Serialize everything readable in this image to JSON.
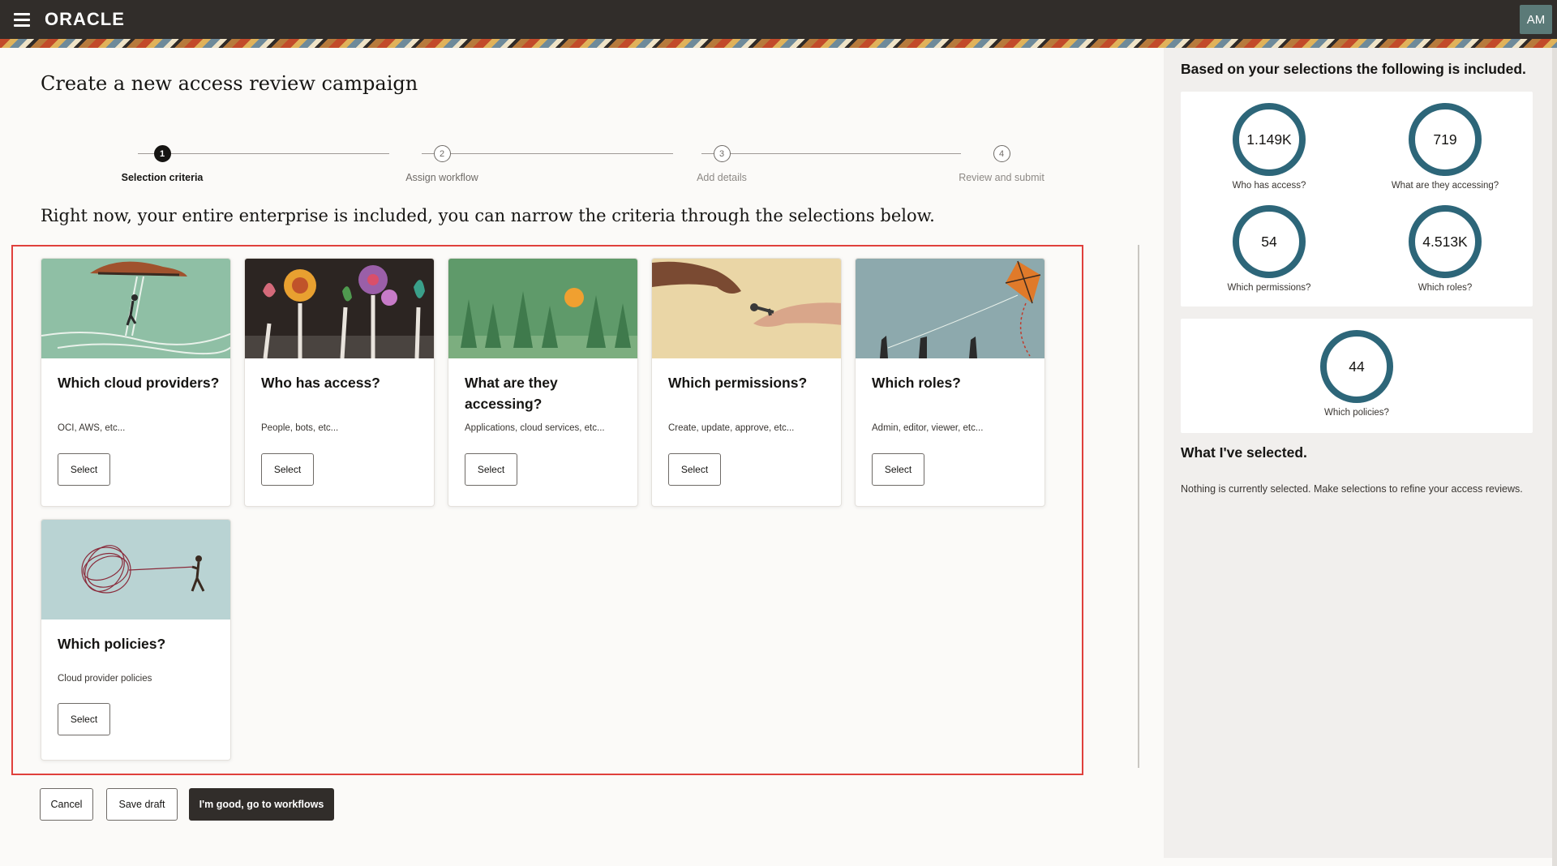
{
  "header": {
    "menu_icon": "hamburger-menu-icon",
    "logo": "ORACLE",
    "avatar": "AM"
  },
  "page": {
    "title": "Create a new access review campaign",
    "intro": "Right now, your entire enterprise is included, you can narrow the criteria through the selections below."
  },
  "train": {
    "steps": [
      {
        "number": "1",
        "label": "Selection criteria",
        "state": "active"
      },
      {
        "number": "2",
        "label": "Assign workflow",
        "state": "upcoming"
      },
      {
        "number": "3",
        "label": "Add details",
        "state": "disabled"
      },
      {
        "number": "4",
        "label": "Review and submit",
        "state": "disabled"
      }
    ]
  },
  "cards": [
    {
      "title": "Which cloud providers?",
      "desc": "OCI, AWS, etc...",
      "button": "Select",
      "image": "climber-cloud-illustration"
    },
    {
      "title": "Who has access?",
      "desc": "People, bots, etc...",
      "button": "Select",
      "image": "hands-flowers-illustration"
    },
    {
      "title": "What are they accessing?",
      "desc": "Applications, cloud services, etc...",
      "button": "Select",
      "image": "forest-sun-illustration"
    },
    {
      "title": "Which permissions?",
      "desc": "Create, update, approve, etc...",
      "button": "Select",
      "image": "hands-key-illustration"
    },
    {
      "title": "Which roles?",
      "desc": "Admin, editor, viewer, etc...",
      "button": "Select",
      "image": "kite-illustration"
    },
    {
      "title": "Which policies?",
      "desc": "Cloud provider policies",
      "button": "Select",
      "image": "tangled-string-illustration"
    }
  ],
  "footer": {
    "cancel": "Cancel",
    "save_draft": "Save draft",
    "continue": "I'm good, go to workflows"
  },
  "summary": {
    "title": "Based on your selections the following is included.",
    "metrics": [
      {
        "value": "1.149K",
        "label": "Who has access?"
      },
      {
        "value": "719",
        "label": "What are they accessing?"
      },
      {
        "value": "54",
        "label": "Which permissions?"
      },
      {
        "value": "4.513K",
        "label": "Which roles?"
      },
      {
        "value": "44",
        "label": "Which policies?"
      }
    ],
    "selected_title": "What I've selected.",
    "selected_text": "Nothing is currently selected. Make selections to refine your access reviews."
  },
  "colors": {
    "header_bg": "#312d2a",
    "ring": "#2d6679",
    "highlight_border": "#e0403c"
  }
}
